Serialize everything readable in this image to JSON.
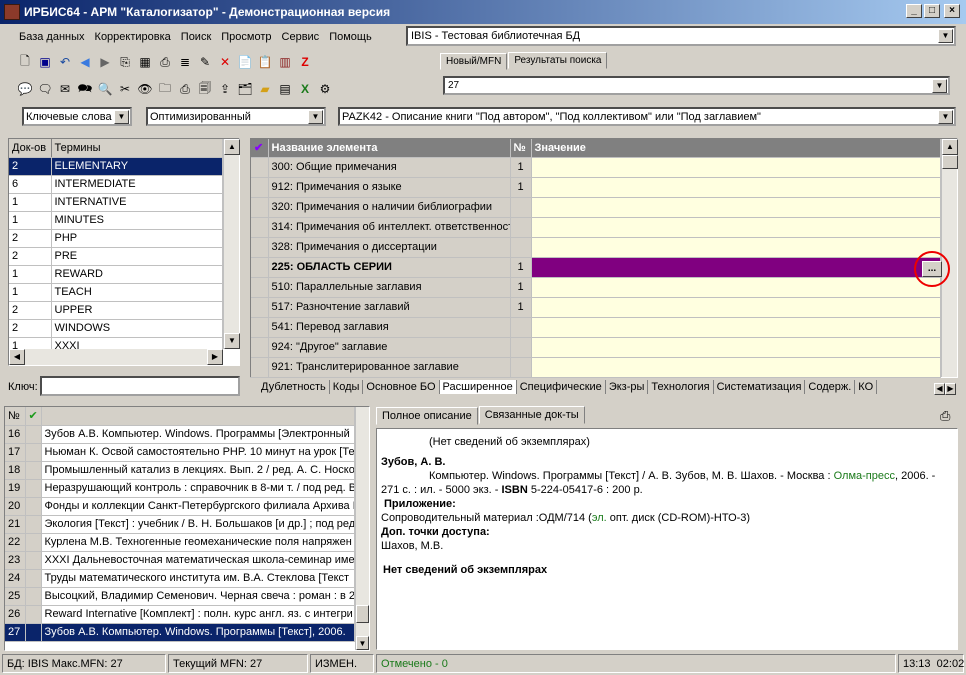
{
  "window": {
    "title": "ИРБИС64 - АРМ \"Каталогизатор\" - Демонстрационная версия"
  },
  "menu": [
    "База данных",
    "Корректировка",
    "Поиск",
    "Просмотр",
    "Сервис",
    "Помощь"
  ],
  "db_select": "IBIS - Тестовая библиотечная БД",
  "mfn_tabs": [
    "Новый/MFN",
    "Результаты поиска"
  ],
  "mfn_value": "27",
  "search_mode": "Ключевые слова",
  "search_option": "Оптимизированный",
  "worksheet": "PAZK42 - Описание книги \"Под автором\", \"Под коллективом\" или \"Под заглавием\"",
  "terms": {
    "headers": [
      "Док-ов",
      "Термины"
    ],
    "rows": [
      [
        "2",
        "ELEMENTARY"
      ],
      [
        "6",
        "INTERMEDIATE"
      ],
      [
        "1",
        "INTERNATIVE"
      ],
      [
        "1",
        "MINUTES"
      ],
      [
        "2",
        "PHP"
      ],
      [
        "2",
        "PRE"
      ],
      [
        "1",
        "REWARD"
      ],
      [
        "1",
        "TEACH"
      ],
      [
        "2",
        "UPPER"
      ],
      [
        "2",
        "WINDOWS"
      ],
      [
        "1",
        "XXXI"
      ]
    ],
    "key_label": "Ключ:"
  },
  "fields": {
    "headers": [
      "Название элемента",
      "№",
      "Значение"
    ],
    "rows": [
      {
        "name": "300: Общие примечания",
        "num": "1"
      },
      {
        "name": "912: Примечания о языке",
        "num": "1"
      },
      {
        "name": "320: Примечания о наличии библиографии",
        "num": ""
      },
      {
        "name": "314: Примечания об интеллект. ответственности",
        "num": ""
      },
      {
        "name": "328: Примечания о диссертации",
        "num": ""
      },
      {
        "name": "225: ОБЛАСТЬ СЕРИИ",
        "num": "1"
      },
      {
        "name": "510: Параллельные заглавия",
        "num": "1"
      },
      {
        "name": "517: Разночтение заглавий",
        "num": "1"
      },
      {
        "name": "541: Перевод заглавия",
        "num": ""
      },
      {
        "name": "924: \"Другое\" заглавие",
        "num": ""
      },
      {
        "name": "921: Транслитерированное заглавие",
        "num": ""
      }
    ],
    "ellipsis": "...",
    "tabs": [
      "Дублетность",
      "Коды",
      "Основное БО",
      "Расширенное",
      "Специфические",
      "Экз-ры",
      "Технология",
      "Систематизация",
      "Содерж.",
      "КО"
    ]
  },
  "records": {
    "headers": [
      "№"
    ],
    "rows": [
      [
        "16",
        "Зубов А.В. Компьютер. Windows. Программы [Электронный"
      ],
      [
        "17",
        "Ньюман К. Освой самостоятельно PHP. 10 минут на урок [Те"
      ],
      [
        "18",
        "Промышленный катализ в лекциях. Вып. 2 / ред. А. С. Носко"
      ],
      [
        "19",
        "Неразрушающий контроль : справочник в 8-ми т. / под ред. В"
      ],
      [
        "20",
        "Фонды и коллекции Санкт-Петербургского филиала Архива Р"
      ],
      [
        "21",
        "Экология [Текст] : учебник / В. Н. Большаков [и др.] ; под ред"
      ],
      [
        "22",
        "Курлена М.В. Техногенные геомеханические поля напряжен"
      ],
      [
        "23",
        "XXXI Дальневосточная математическая школа-семинар име"
      ],
      [
        "24",
        "Труды математического института им. В.А. Стеклова [Текст"
      ],
      [
        "25",
        "Высоцкий, Владимир Семенович. Черная свеча : роман : в 2"
      ],
      [
        "26",
        "Reward Internative [Комплект] : полн. курс англ. яз. с интегри"
      ],
      [
        "27",
        "Зубов А.В. Компьютер. Windows. Программы [Текст], 2006."
      ]
    ]
  },
  "desc_tabs": [
    "Полное описание",
    "Связанные док-ты"
  ],
  "description": {
    "line1": "(Нет сведений об экземплярах)",
    "author": "Зубов, А. В.",
    "text1": "Компьютер. Windows. Программы [Текст] / А. В. Зубов, М. В. Шахов. - Москва : ",
    "publisher": "Олма-пресс",
    "text2": ", 2006. - 271 с. : ил. - 5000 экз. - ",
    "isbn_label": "ISBN",
    "text3": " 5-224-05417-6 : 200 р.",
    "app_label": "Приложение:",
    "app_text1": "Сопроводительный материал :ОДМ/714 (",
    "app_link": "эл.",
    "app_text2": " опт. диск (CD-ROM)-НТО-3)",
    "access_label": "Доп. точки доступа:",
    "access_value": "Шахов, М.В.",
    "no_copies": "Нет сведений об экземплярах"
  },
  "status": {
    "db": "БД: IBIS Макс.MFN: 27",
    "current": "Текущий MFN: 27",
    "changed": "ИЗМЕН.",
    "marked": "Отмечено - 0",
    "time": "13:13",
    "time2": "02:02"
  },
  "colors": {
    "title": "#0a246a",
    "selected_row": "#0a246a",
    "active_field": "#800080",
    "value_bg": "#ffffe0"
  }
}
